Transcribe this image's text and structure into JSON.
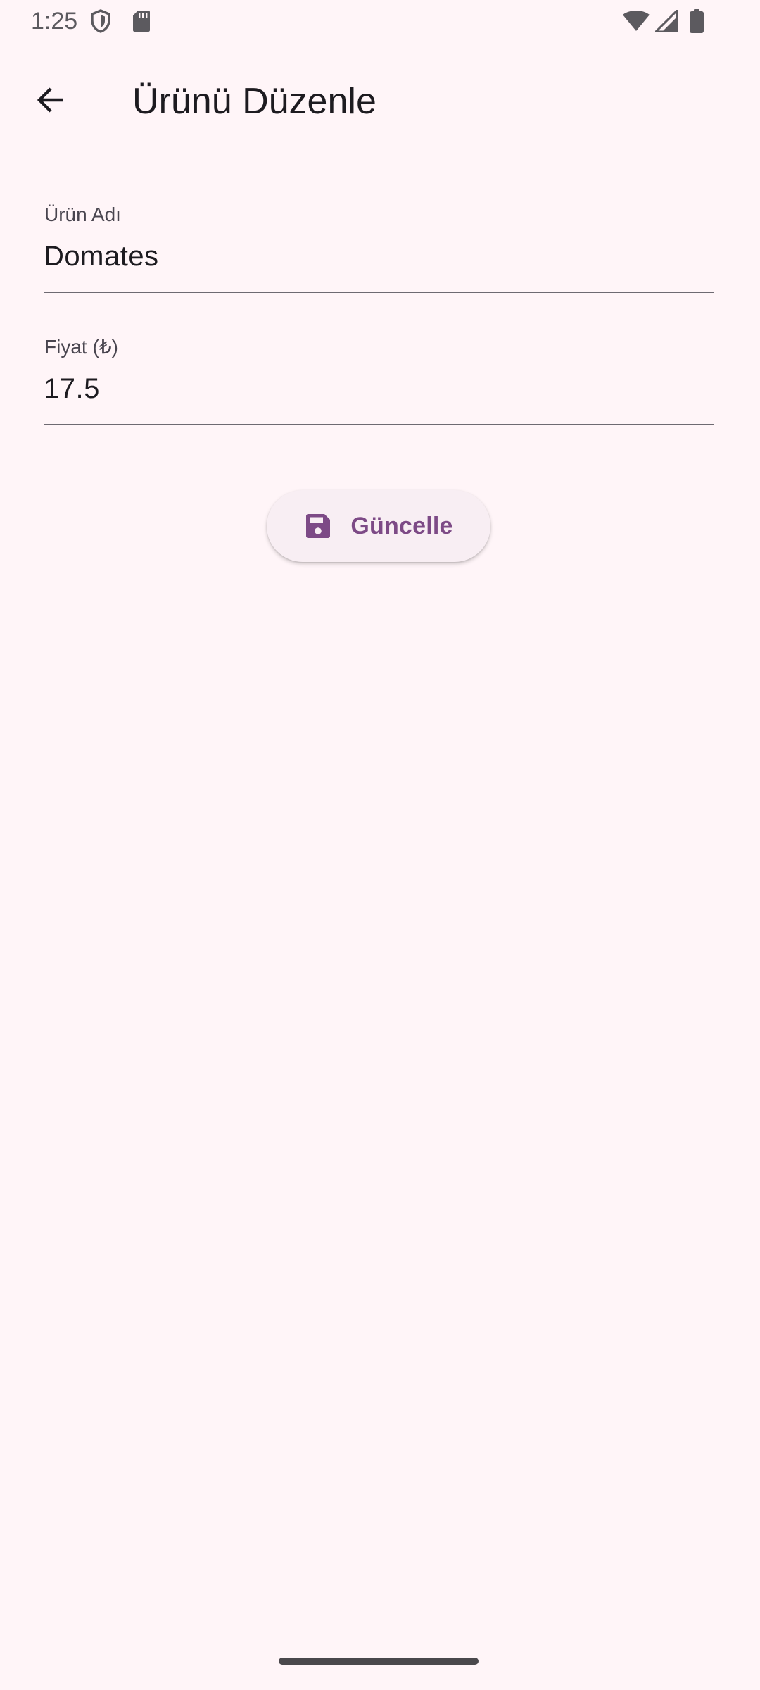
{
  "status_bar": {
    "time": "1:25",
    "icons": [
      "shield-icon",
      "sd-card-icon",
      "wifi-icon",
      "signal-icon",
      "battery-icon"
    ]
  },
  "app_bar": {
    "back_icon": "arrow-back-icon",
    "title": "Ürünü Düzenle"
  },
  "form": {
    "product_name": {
      "label": "Ürün Adı",
      "value": "Domates"
    },
    "price": {
      "label": "Fiyat (₺)",
      "value": "17.5"
    }
  },
  "update_button": {
    "icon": "save-icon",
    "label": "Güncelle"
  },
  "colors": {
    "background": "#FFF5F8",
    "primary": "#7D4A86",
    "button_surface": "#F8EEF3",
    "on_surface": "#1D1B20",
    "on_surface_variant": "#49454F"
  }
}
